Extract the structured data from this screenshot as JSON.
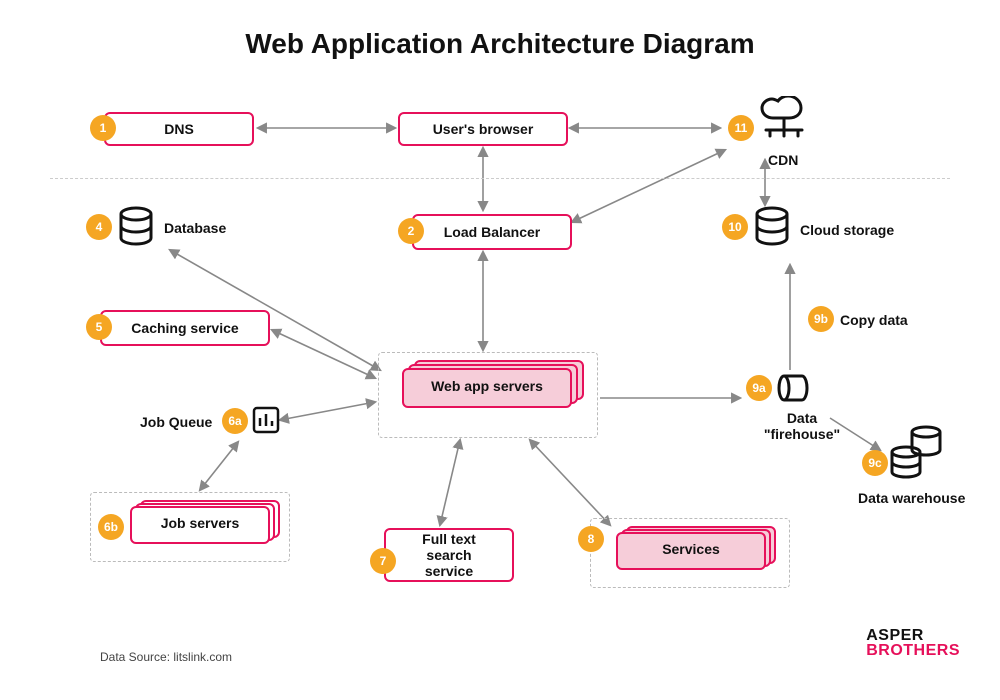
{
  "title": "Web Application Architecture Diagram",
  "data_source": "Data Source: litslink.com",
  "logo": {
    "line1": "ASPER",
    "line2": "BROTHERS"
  },
  "nodes": {
    "dns": {
      "badge": "1",
      "label": "DNS"
    },
    "browser": {
      "label": "User's browser"
    },
    "cdn": {
      "badge": "11",
      "label": "CDN"
    },
    "load_balancer": {
      "badge": "2",
      "label": "Load Balancer"
    },
    "database": {
      "badge": "4",
      "label": "Database"
    },
    "caching": {
      "badge": "5",
      "label": "Caching service"
    },
    "job_queue": {
      "badge": "6a",
      "label": "Job Queue"
    },
    "job_servers": {
      "badge": "6b",
      "label": "Job servers"
    },
    "web_app": {
      "label": "Web app servers"
    },
    "fulltext": {
      "badge": "7",
      "label": "Full text\nsearch service"
    },
    "services": {
      "badge": "8",
      "label": "Services"
    },
    "firehose": {
      "badge": "9a",
      "label": "Data\n\"firehouse\""
    },
    "copy_data": {
      "badge": "9b",
      "label": "Copy data"
    },
    "warehouse": {
      "badge": "9c",
      "label": "Data warehouse"
    },
    "cloud_storage": {
      "badge": "10",
      "label": "Cloud storage"
    }
  },
  "colors": {
    "accent": "#e6105a",
    "badge": "#f5a623"
  }
}
